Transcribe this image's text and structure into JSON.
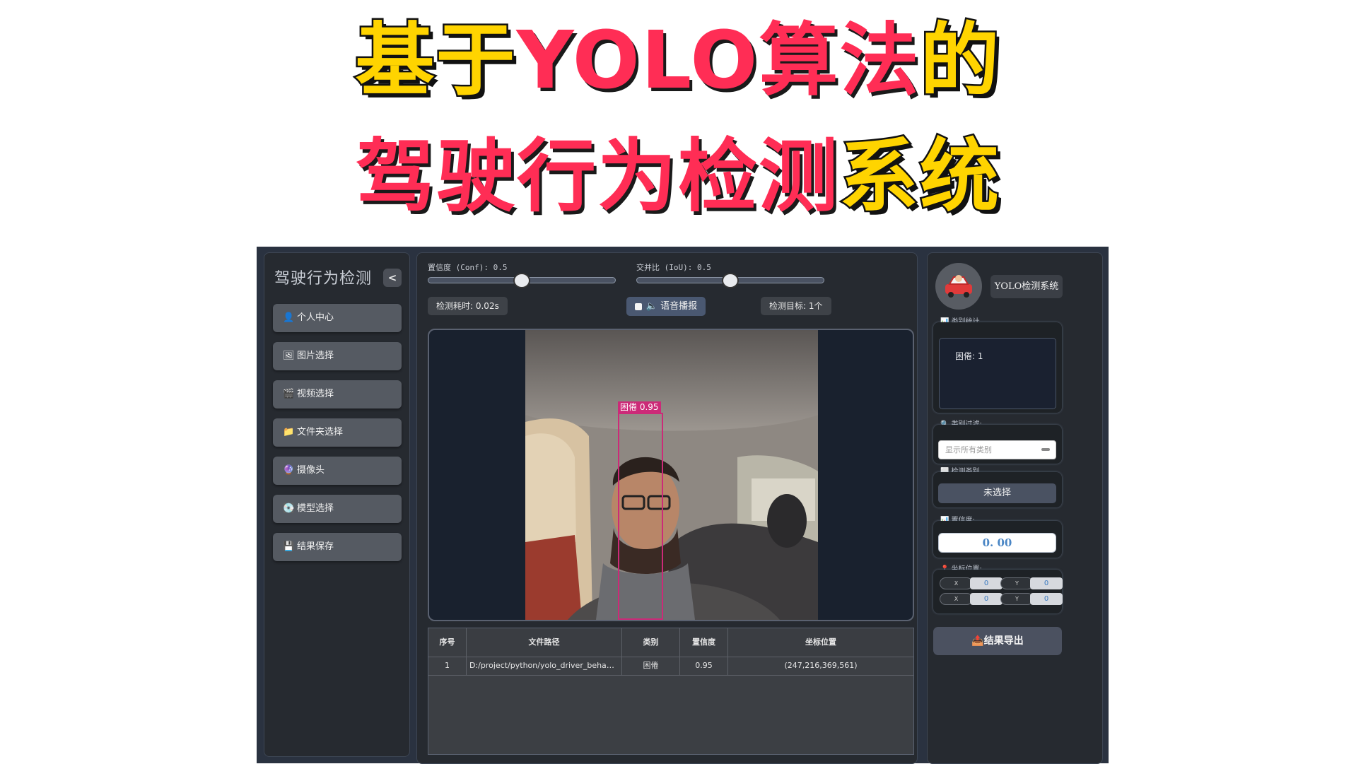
{
  "banner": {
    "line1_a": "基于",
    "line1_b": "YOLO算法",
    "line1_c": "的",
    "line2_a": "驾驶行为检测",
    "line2_b": "系统"
  },
  "sidebar": {
    "title": "驾驶行为检测",
    "collapse_icon": "chevron-left-icon",
    "items": [
      {
        "icon": "👤",
        "label": "个人中心"
      },
      {
        "icon": "🖼",
        "label": "图片选择"
      },
      {
        "icon": "🎬",
        "label": "视频选择"
      },
      {
        "icon": "📁",
        "label": "文件夹选择"
      },
      {
        "icon": "🔮",
        "label": "摄像头"
      },
      {
        "icon": "💽",
        "label": "模型选择"
      },
      {
        "icon": "💾",
        "label": "结果保存"
      }
    ]
  },
  "controls": {
    "conf_label": "置信度 (Conf): 0.5",
    "conf_value": 0.5,
    "iou_label": "交并比 (IoU): 0.5",
    "iou_value": 0.5,
    "time_chip": "检测耗时: 0.02s",
    "voice_label": "语音播报",
    "target_chip": "检测目标: 1个"
  },
  "detection": {
    "label": "困倦 0.95"
  },
  "table": {
    "headers": [
      "序号",
      "文件路径",
      "类别",
      "置信度",
      "坐标位置"
    ],
    "rows": [
      [
        "1",
        "D:/project/python/yolo_driver_behavior/test_medi...",
        "困倦",
        "0.95",
        "(247,216,369,561)"
      ]
    ]
  },
  "right_panel": {
    "system_title": "YOLO检测系统",
    "stats_title": "类别统计",
    "stats_text": "困倦: 1",
    "filter_title": "类别过滤:",
    "filter_placeholder": "显示所有类别",
    "class_title": "检测类别",
    "class_value": "未选择",
    "conf_title": "置信度:",
    "conf_value": "0. 00",
    "coord_title": "坐标位置:",
    "coords": [
      {
        "axis": "X",
        "value": "0"
      },
      {
        "axis": "Y",
        "value": "0"
      },
      {
        "axis": "X",
        "value": "0"
      },
      {
        "axis": "Y",
        "value": "0"
      }
    ],
    "export_label": "结果导出"
  },
  "colors": {
    "banner_yellow": "#ffd400",
    "banner_red": "#ff2d55",
    "detection_box": "#cc2a78",
    "app_bg": "#2a3240"
  }
}
